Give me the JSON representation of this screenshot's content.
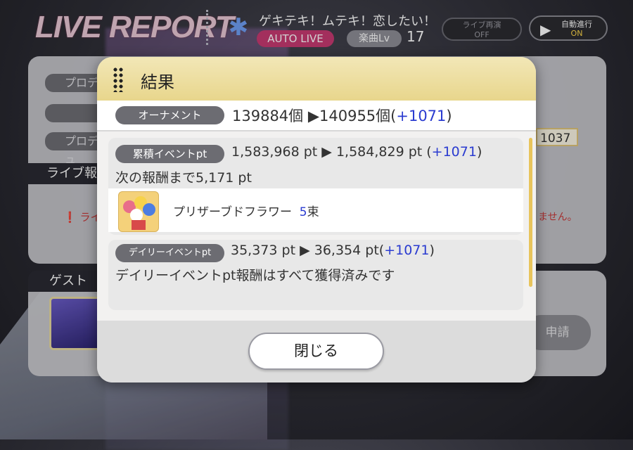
{
  "header": {
    "live_report": "LIVE REPORT",
    "song_title": "ゲキテキ！ムテキ！恋したい！",
    "auto_live": "AUTO LIVE",
    "level_label": "楽曲Lv",
    "level_value": "17",
    "replay_label": "ライブ再演",
    "replay_state": "OFF",
    "auto_label": "自動進行",
    "auto_state": "ON"
  },
  "background": {
    "producer_row_1": "プロデ",
    "producer_row_3": "プロデュ",
    "live_title": "ライブ報",
    "warn_left": "ライ",
    "warn_right": "ません。",
    "value_box": "1037",
    "guest_title": "ゲスト",
    "request_button": "申請"
  },
  "modal": {
    "title": "結果",
    "ornament": {
      "label": "オーナメント",
      "from": "139884個",
      "arrow": " ▶",
      "to": "140955個(",
      "delta": "+1071",
      "close_paren": ")"
    },
    "cumulative": {
      "label": "累積イベントpt",
      "from": "1,583,968 pt",
      "arrow": "  ▶  ",
      "to": "1,584,829 pt (",
      "delta": "+1071",
      "close_paren": ")",
      "next_reward": "次の報酬まで5,171 pt",
      "reward_name": "プリザーブドフラワー",
      "reward_qty": "5",
      "reward_unit": "束"
    },
    "daily": {
      "label": "デイリーイベントpt",
      "from": "35,373 pt",
      "arrow": " ▶ ",
      "to": "36,354 pt(",
      "delta": "+1071",
      "close_paren": ")",
      "done_text": "デイリーイベントpt報酬はすべて獲得済みです"
    },
    "close_button": "閉じる"
  },
  "colors": {
    "header_gold": "#e8d68c",
    "pill_gray": "#6c6c72",
    "delta_blue": "#2a3bd0",
    "auto_live_pink": "#c73a72"
  }
}
